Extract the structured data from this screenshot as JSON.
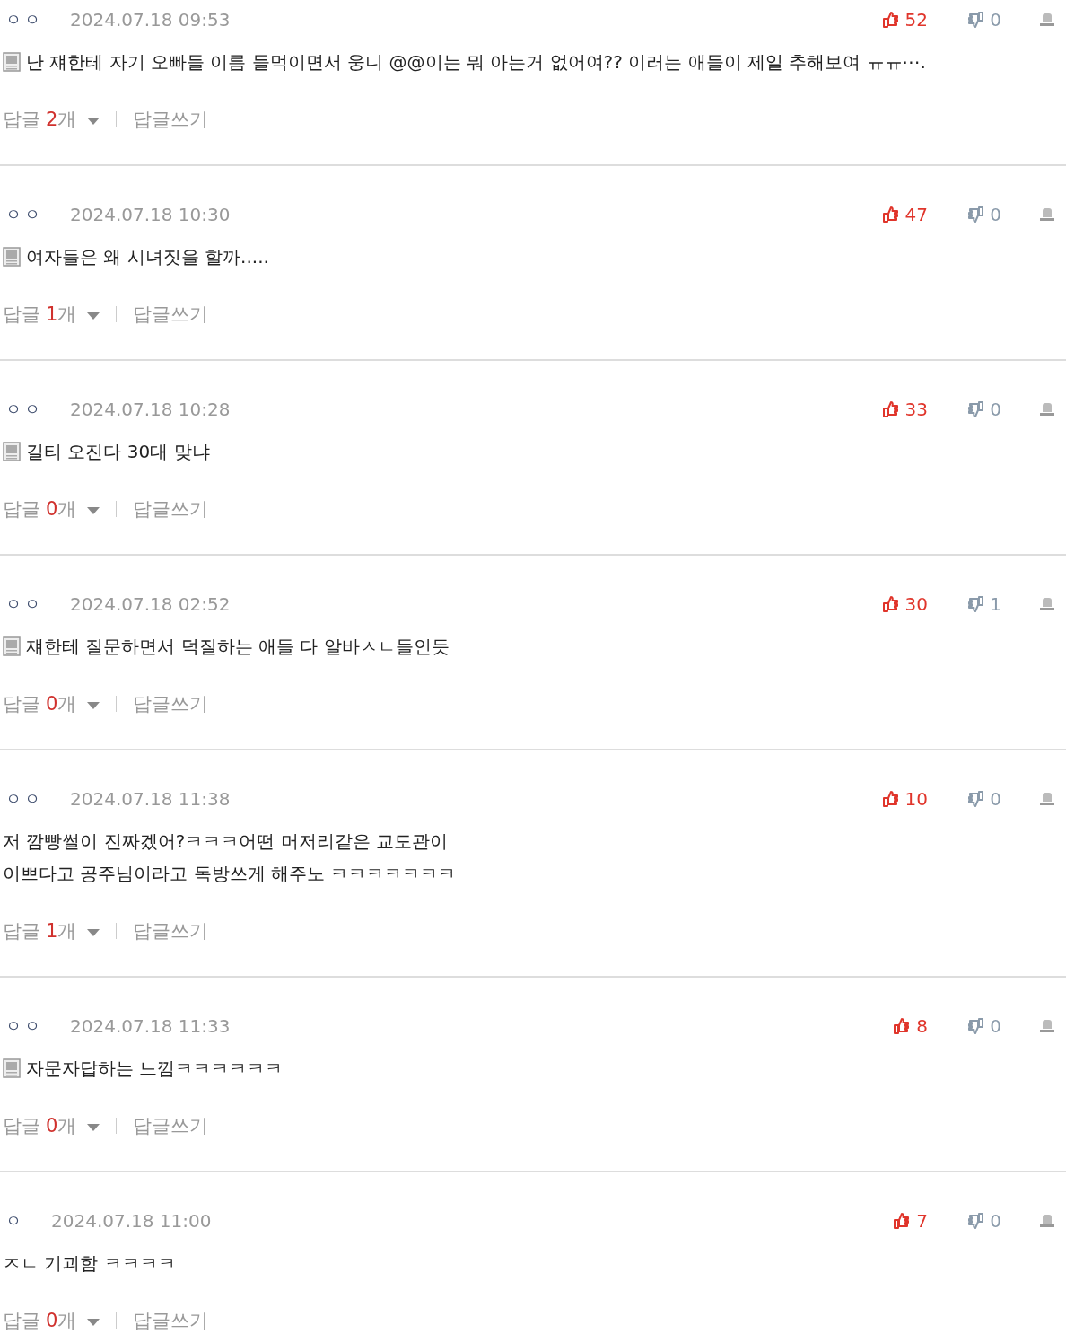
{
  "comments": [
    {
      "author": "ㅇㅇ",
      "date": "2024.07.18 09:53",
      "likes": "52",
      "dislikes": "0",
      "kind": "image",
      "lines": [
        "난 쟤한테 자기 오빠들 이름 들먹이면서 웅니 @@이는 뭐 아는거 없어여?? 이러는 애들이 제일 추해보여 ㅠㅠ⋯."
      ],
      "reply_label": "답글",
      "reply_count": "2",
      "reply_unit": "개",
      "write_label": "답글쓰기"
    },
    {
      "author": "ㅇㅇ",
      "date": "2024.07.18 10:30",
      "likes": "47",
      "dislikes": "0",
      "kind": "image",
      "lines": [
        "여자들은 왜 시녀짓을 할까....."
      ],
      "reply_label": "답글",
      "reply_count": "1",
      "reply_unit": "개",
      "write_label": "답글쓰기"
    },
    {
      "author": "ㅇㅇ",
      "date": "2024.07.18 10:28",
      "likes": "33",
      "dislikes": "0",
      "kind": "image",
      "lines": [
        "길티 오진다 30대 맞냐"
      ],
      "reply_label": "답글",
      "reply_count": "0",
      "reply_unit": "개",
      "write_label": "답글쓰기"
    },
    {
      "author": "ㅇㅇ",
      "date": "2024.07.18 02:52",
      "likes": "30",
      "dislikes": "1",
      "kind": "image",
      "lines": [
        "쟤한테 질문하면서 덕질하는 애들 다 알바ㅅㄴ들인듯"
      ],
      "reply_label": "답글",
      "reply_count": "0",
      "reply_unit": "개",
      "write_label": "답글쓰기"
    },
    {
      "author": "ㅇㅇ",
      "date": "2024.07.18 11:38",
      "likes": "10",
      "dislikes": "0",
      "kind": "text",
      "lines": [
        "저 깜빵썰이 진짜겠어?ㅋㅋㅋ어떤 머저리같은 교도관이",
        "이쁘다고 공주님이라고 독방쓰게 해주노 ㅋㅋㅋㅋㅋㅋㅋ"
      ],
      "reply_label": "답글",
      "reply_count": "1",
      "reply_unit": "개",
      "write_label": "답글쓰기"
    },
    {
      "author": "ㅇㅇ",
      "date": "2024.07.18 11:33",
      "likes": "8",
      "dislikes": "0",
      "kind": "image",
      "lines": [
        "자문자답하는 느낌ㅋㅋㅋㅋㅋㅋ"
      ],
      "reply_label": "답글",
      "reply_count": "0",
      "reply_unit": "개",
      "write_label": "답글쓰기"
    },
    {
      "author": "ㅇ",
      "date": "2024.07.18 11:00",
      "likes": "7",
      "dislikes": "0",
      "kind": "text",
      "lines": [
        "ㅈㄴ 기괴함 ㅋㅋㅋㅋ"
      ],
      "reply_label": "답글",
      "reply_count": "0",
      "reply_unit": "개",
      "write_label": "답글쓰기"
    }
  ]
}
